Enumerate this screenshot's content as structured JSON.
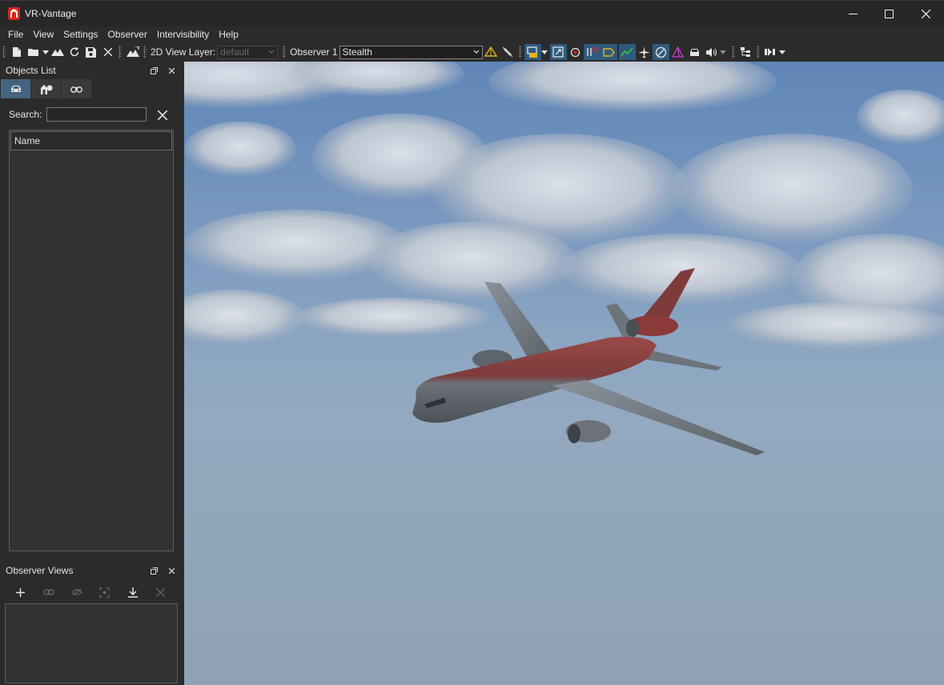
{
  "window": {
    "title": "VR-Vantage",
    "minimize_icon": "minimize-icon",
    "maximize_icon": "maximize-icon",
    "close_icon": "close-icon"
  },
  "menu": [
    "File",
    "View",
    "Settings",
    "Observer",
    "Intervisibility",
    "Help"
  ],
  "toolbar": {
    "view_layer_label": "2D View Layer:",
    "view_layer_value": "default",
    "observer_label": "Observer 1",
    "observer_value": "Stealth"
  },
  "objects_list": {
    "title": "Objects List",
    "search_label": "Search:",
    "search_value": "",
    "column_name": "Name",
    "tabs": [
      "vehicle-icon",
      "buildings-icon",
      "binoculars-icon"
    ]
  },
  "observer_views": {
    "title": "Observer Views",
    "buttons": [
      "add-icon",
      "link-icon",
      "hide-icon",
      "focus-icon",
      "download-icon",
      "delete-icon"
    ]
  },
  "colors": {
    "accent": "#2f5a7e",
    "tab_active": "#44647f",
    "aircraft_top": "#8a3535"
  }
}
